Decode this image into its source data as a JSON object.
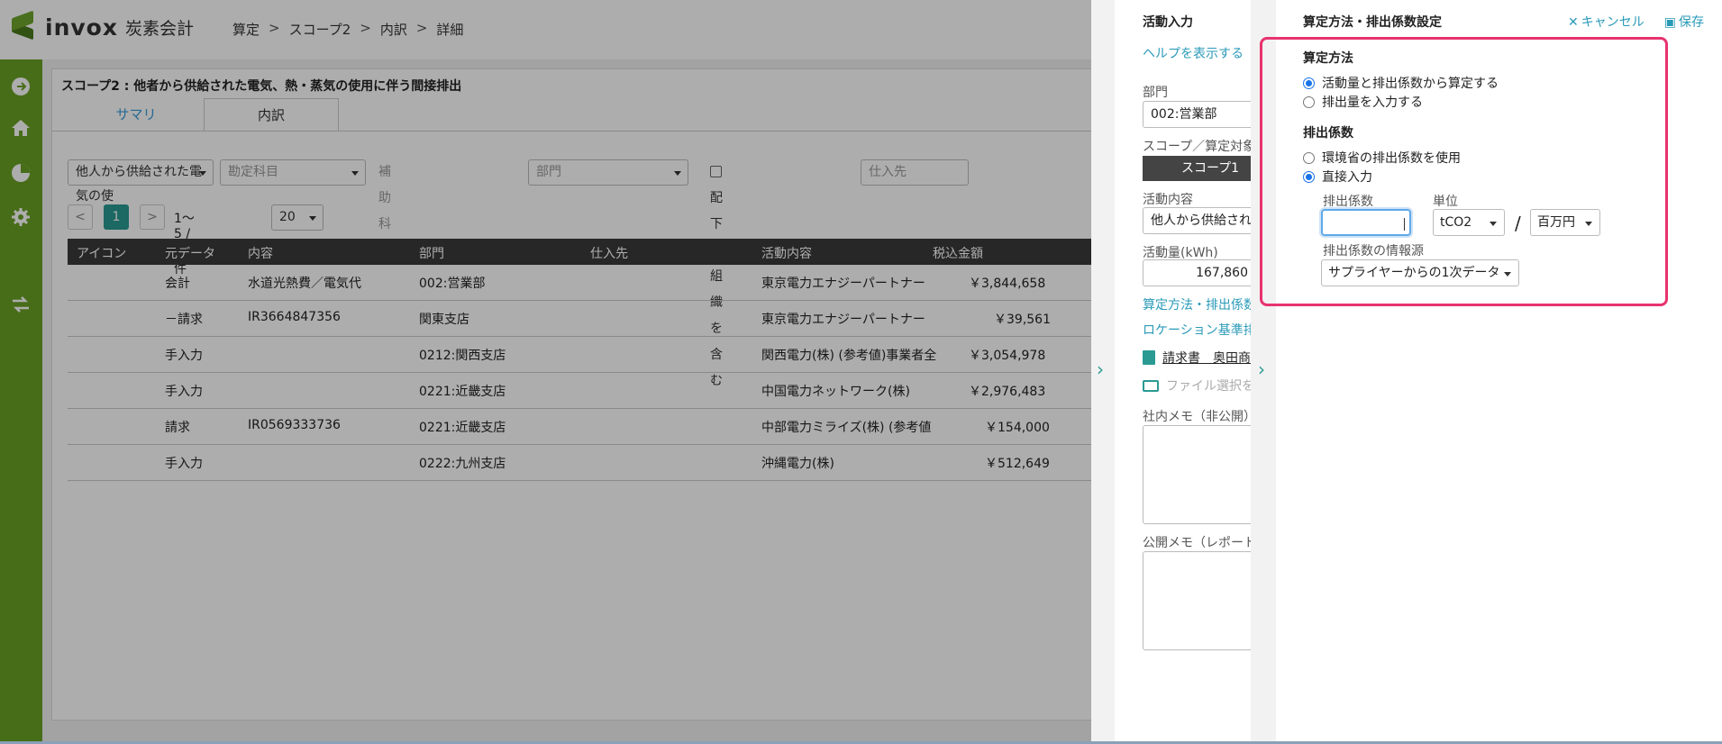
{
  "app": {
    "logo_text": "invox",
    "logo_sub": "炭素会計"
  },
  "breadcrumb": [
    "算定",
    "スコープ2",
    "内訳",
    "詳細"
  ],
  "breadcrumb_sep": ">",
  "sidebar_icons": [
    "arrow-right-circle-icon",
    "home-icon",
    "pie-chart-icon",
    "gear-icon",
    "transfer-icon"
  ],
  "card": {
    "title": "スコープ2 : 他者から供給された電気、熱・蒸気の使用に伴う間接排出",
    "tabs": [
      "サマリ",
      "内訳"
    ],
    "active_tab": "内訳"
  },
  "filters": {
    "category": "他人から供給された電気の使",
    "account_placeholder": "勘定科目",
    "sub_account": "補助科目",
    "department_placeholder": "部門",
    "include_children": "配下の組織を含む",
    "supplier_placeholder": "仕入先"
  },
  "pager": {
    "prev": "<",
    "page": "1",
    "next": ">",
    "range": "1〜5 / 全5件",
    "per_page": "20"
  },
  "table": {
    "headers": [
      "アイコン",
      "元データ",
      "内容",
      "部門",
      "仕入先",
      "活動内容",
      "税込金額"
    ],
    "rows": [
      [
        "",
        "会計",
        "水道光熱費／電気代",
        "002:営業部",
        "",
        "東京電力エナジーパートナー",
        "￥3,844,658"
      ],
      [
        "",
        "－請求",
        "IR3664847356",
        "関東支店",
        "",
        "東京電力エナジーパートナー",
        "￥39,561"
      ],
      [
        "",
        "手入力",
        "",
        "0212:関西支店",
        "",
        "関西電力(株) (参考値)事業者全",
        "￥3,054,978"
      ],
      [
        "",
        "手入力",
        "",
        "0221:近畿支店",
        "",
        "中国電力ネットワーク(株)",
        "￥2,976,483"
      ],
      [
        "",
        "請求",
        "IR0569333736",
        "0221:近畿支店",
        "",
        "中部電力ミライズ(株) (参考値",
        "￥154,000"
      ],
      [
        "",
        "手入力",
        "",
        "0222:九州支店",
        "",
        "沖縄電力(株)",
        "￥512,649"
      ]
    ]
  },
  "activity_panel": {
    "title": "活動入力",
    "help_link": "ヘルプを表示する",
    "dept_label": "部門",
    "dept_value": "002:営業部",
    "scope_label": "スコープ／算定対象",
    "scope_value": "スコープ1",
    "content_label": "活動内容",
    "content_value": "他人から供給され",
    "amount_label": "活動量(kWh)",
    "amount_value": "167,860",
    "method_link": "算定方法・排出係数",
    "location_link": "ロケーション基準排",
    "attachment": "請求書　奥田商",
    "file_select": "ファイル選択を",
    "internal_memo": "社内メモ（非公開）",
    "public_memo": "公開メモ（レポート"
  },
  "settings_panel": {
    "title": "算定方法・排出係数設定",
    "cancel": "キャンセル",
    "save": "保存",
    "method_heading": "算定方法",
    "method_options": [
      "活動量と排出係数から算定する",
      "排出量を入力する"
    ],
    "method_selected": 0,
    "factor_heading": "排出係数",
    "factor_options": [
      "環境省の排出係数を使用",
      "直接入力"
    ],
    "factor_selected": 1,
    "factor_label": "排出係数",
    "factor_value": "",
    "unit_label": "単位",
    "unit_value": "tCO2",
    "per_value": "百万円",
    "slash": "/",
    "source_label": "排出係数の情報源",
    "source_value": "サプライヤーからの1次データ"
  },
  "colors": {
    "sidebar": "#6aa125",
    "accent": "#2a9a93",
    "link": "#2a9ab8",
    "highlight": "#e8336e"
  }
}
